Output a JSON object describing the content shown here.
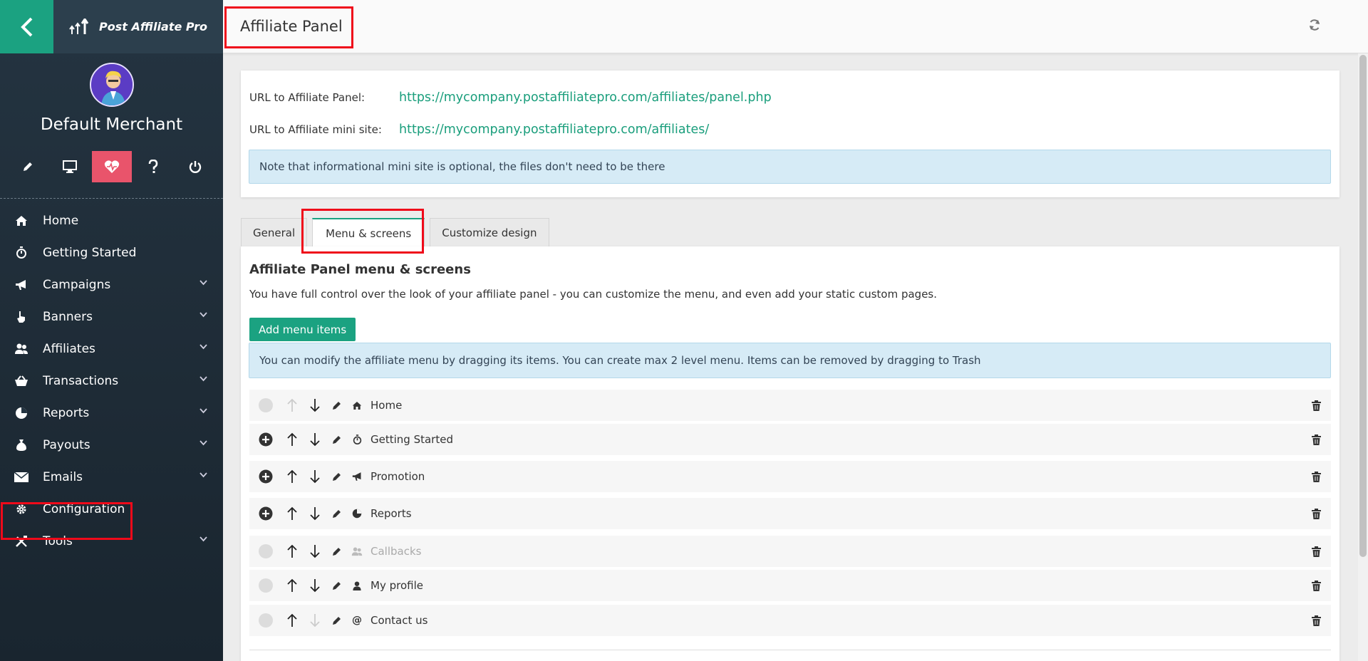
{
  "app": {
    "brand_name": "Post Affiliate Pro",
    "merchant_name": "Default Merchant"
  },
  "quick_icons": [
    "pencil-icon",
    "monitor-icon",
    "heart-pulse-icon",
    "question-icon",
    "power-icon"
  ],
  "nav": {
    "items": [
      {
        "label": "Home",
        "icon": "home-icon",
        "expandable": false
      },
      {
        "label": "Getting Started",
        "icon": "stopwatch-icon",
        "expandable": false
      },
      {
        "label": "Campaigns",
        "icon": "megaphone-icon",
        "expandable": true
      },
      {
        "label": "Banners",
        "icon": "hand-pointer-icon",
        "expandable": true
      },
      {
        "label": "Affiliates",
        "icon": "users-icon",
        "expandable": true
      },
      {
        "label": "Transactions",
        "icon": "basket-icon",
        "expandable": true
      },
      {
        "label": "Reports",
        "icon": "pie-chart-icon",
        "expandable": true
      },
      {
        "label": "Payouts",
        "icon": "money-bag-icon",
        "expandable": true
      },
      {
        "label": "Emails",
        "icon": "envelope-icon",
        "expandable": true
      },
      {
        "label": "Configuration",
        "icon": "gear-icon",
        "expandable": false
      },
      {
        "label": "Tools",
        "icon": "tools-icon",
        "expandable": true
      }
    ]
  },
  "header": {
    "title": "Affiliate Panel"
  },
  "urls": {
    "panel_label": "URL to Affiliate Panel:",
    "panel_url": "https://mycompany.postaffiliatepro.com/affiliates/panel.php",
    "mini_label": "URL to Affiliate mini site:",
    "mini_url": "https://mycompany.postaffiliatepro.com/affiliates/",
    "note": "Note that informational mini site is optional, the files don't need to be there"
  },
  "tabs": [
    {
      "label": "General",
      "active": false
    },
    {
      "label": "Menu & screens",
      "active": true
    },
    {
      "label": "Customize design",
      "active": false
    }
  ],
  "menu_screens": {
    "title": "Affiliate Panel menu & screens",
    "description": "You have full control over the look of your affiliate panel - you can customize the menu, and even add your static custom pages.",
    "add_button": "Add menu items",
    "info": "You can modify the affiliate menu by dragging its items. You can create max 2 level menu. Items can be removed by dragging to Trash",
    "rows": [
      {
        "label": "Home",
        "icon": "home-icon",
        "can_add": false,
        "up_enabled": false,
        "down_enabled": true,
        "label_disabled": false
      },
      {
        "label": "Getting Started",
        "icon": "stopwatch-icon",
        "can_add": true,
        "up_enabled": true,
        "down_enabled": true,
        "label_disabled": false
      },
      {
        "label": "Promotion",
        "icon": "megaphone-icon",
        "can_add": true,
        "up_enabled": true,
        "down_enabled": true,
        "label_disabled": false
      },
      {
        "label": "Reports",
        "icon": "pie-chart-icon",
        "can_add": true,
        "up_enabled": true,
        "down_enabled": true,
        "label_disabled": false
      },
      {
        "label": "Callbacks",
        "icon": "users-icon",
        "can_add": false,
        "up_enabled": true,
        "down_enabled": true,
        "label_disabled": true
      },
      {
        "label": "My profile",
        "icon": "user-icon",
        "can_add": false,
        "up_enabled": true,
        "down_enabled": true,
        "label_disabled": false
      },
      {
        "label": "Contact us",
        "icon": "at-icon",
        "can_add": false,
        "up_enabled": true,
        "down_enabled": false,
        "label_disabled": false
      }
    ]
  }
}
